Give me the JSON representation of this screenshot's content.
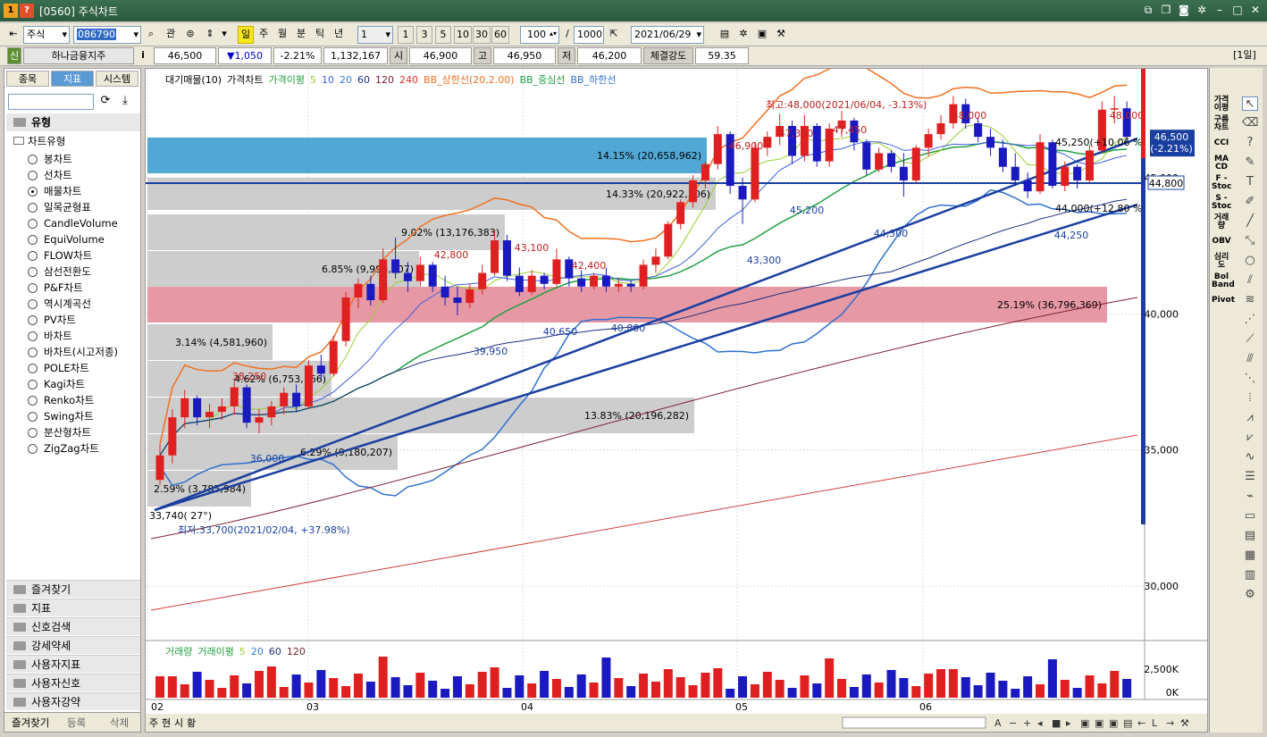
{
  "window": {
    "title": "[0560] 주식차트",
    "num_badge": "1",
    "help_badge": "?"
  },
  "toolbar": {
    "market": "주식",
    "code": "086790",
    "gwan": "관",
    "periods": [
      "일",
      "주",
      "월",
      "분",
      "틱",
      "년"
    ],
    "interval": "1",
    "quick_intervals": [
      "1",
      "3",
      "5",
      "10",
      "30",
      "60"
    ],
    "count_value": "100",
    "count_max": "1000",
    "date": "2021/06/29"
  },
  "info": {
    "badge": "신",
    "name": "하나금융지주",
    "i_label": "i",
    "price": "46,500",
    "change": "▼1,050",
    "change_pct": "-2.21%",
    "volume": "1,132,167",
    "open_label": "시",
    "open": "46,900",
    "high_label": "고",
    "high": "46,950",
    "low_label": "저",
    "low": "46,200",
    "strength_label": "체결강도",
    "strength": "59.35",
    "period_label": "[1일]"
  },
  "left_panel": {
    "tabs": [
      "종목",
      "지표",
      "시스템"
    ],
    "section_title": "유형",
    "group": "차트유형",
    "items": [
      "봉차트",
      "선차트",
      "매물차트",
      "일목균형표",
      "CandleVolume",
      "EquiVolume",
      "FLOW차트",
      "삼선전환도",
      "P&F차트",
      "역시계곡선",
      "PV차트",
      "바차트",
      "바차트(시고저종)",
      "POLE차트",
      "Kagi차트",
      "Renko차트",
      "Swing차트",
      "분산형차트",
      "ZigZag차트"
    ],
    "selected_index": 2,
    "folders": [
      "즐겨찾기",
      "지표",
      "신호검색",
      "강세약세",
      "사용자지표",
      "사용자신호",
      "사용자강약"
    ],
    "bottom_tabs": [
      "즐겨찾기",
      "등록",
      "삭제"
    ]
  },
  "chart": {
    "legend": [
      "대기매물(10)",
      "가격차트",
      "가격이평",
      "5",
      "10",
      "20",
      "60",
      "120",
      "240",
      "BB_상한선(20,2.00)",
      "BB_중심선",
      "BB_하한선"
    ],
    "volume_legend": [
      "거래량",
      "거래이평",
      "5",
      "20",
      "60",
      "120"
    ],
    "y_ticks": [
      "40,000",
      "35,000",
      "30,000"
    ],
    "y_tick_45": "45,000",
    "volume_ticks": [
      "2,500K",
      "0K"
    ],
    "x_ticks": [
      "02",
      "03",
      "04",
      "05",
      "06"
    ],
    "price_tag": "46,500",
    "price_tag_pct": "(-2.21%)",
    "line_tag": "44,800",
    "max_note": "최고:48,000(2021/06/04, -3.13%)",
    "min_note": "최저:33,700(2021/02/04, +37.98%)",
    "angle_note": "33,740( 27°)",
    "trend_note": "44,000(+12.80 %)",
    "trend_note2": "45,250(+10.06 %)",
    "price_labels": [
      "48,000",
      "48,000",
      "47,350",
      "47,450",
      "46,900",
      "45,200",
      "44,300",
      "44,250",
      "43,300",
      "43,100",
      "42,800",
      "42,400",
      "40,650",
      "40,800",
      "39,950",
      "38,250",
      "36,000"
    ],
    "volume_profile": [
      {
        "label": "14.15% (20,658,962)"
      },
      {
        "label": "14.33% (20,922,506)"
      },
      {
        "label": "9.02% (13,176,383)"
      },
      {
        "label": "6.85% (9,998,207)"
      },
      {
        "label": "25.19% (36,796,369)"
      },
      {
        "label": "3.14% (4,581,960)"
      },
      {
        "label": "4.62% (6,753,166)"
      },
      {
        "label": "13.83% (20,196,282)"
      },
      {
        "label": "6.29% (9,180,207)"
      },
      {
        "label": "2.59% (3,785,984)"
      }
    ]
  },
  "chart_data": {
    "type": "candlestick",
    "ylim": [
      28000,
      49000
    ],
    "candles": [
      [
        33900,
        35200,
        33700,
        34800
      ],
      [
        34800,
        36500,
        34500,
        36200
      ],
      [
        36200,
        37200,
        35800,
        36900
      ],
      [
        36900,
        37000,
        35900,
        36200
      ],
      [
        36200,
        36700,
        35800,
        36400
      ],
      [
        36400,
        36900,
        36100,
        36600
      ],
      [
        36600,
        37600,
        36300,
        37300
      ],
      [
        37300,
        37400,
        35800,
        36000
      ],
      [
        36000,
        36500,
        35600,
        36200
      ],
      [
        36200,
        36800,
        35900,
        36600
      ],
      [
        36600,
        37300,
        36300,
        37100
      ],
      [
        37100,
        37400,
        36400,
        36600
      ],
      [
        36600,
        38300,
        36500,
        38100
      ],
      [
        38100,
        38500,
        37600,
        37800
      ],
      [
        37800,
        39200,
        37700,
        39000
      ],
      [
        39000,
        40800,
        38800,
        40600
      ],
      [
        40600,
        41300,
        40200,
        41100
      ],
      [
        41100,
        41400,
        40300,
        40500
      ],
      [
        40500,
        42400,
        40400,
        42000
      ],
      [
        42000,
        42800,
        41300,
        41500
      ],
      [
        41500,
        41900,
        40800,
        41200
      ],
      [
        41200,
        42100,
        41000,
        41800
      ],
      [
        41800,
        41900,
        40800,
        41000
      ],
      [
        41000,
        41400,
        40300,
        40600
      ],
      [
        40600,
        41000,
        39950,
        40400
      ],
      [
        40400,
        41100,
        40200,
        40900
      ],
      [
        40900,
        41800,
        40700,
        41500
      ],
      [
        41500,
        43100,
        41400,
        42700
      ],
      [
        42700,
        42900,
        41200,
        41400
      ],
      [
        41400,
        41700,
        40650,
        40800
      ],
      [
        40800,
        41600,
        40700,
        41400
      ],
      [
        41400,
        41500,
        40900,
        41100
      ],
      [
        41100,
        42400,
        41000,
        42000
      ],
      [
        42000,
        42100,
        41000,
        41300
      ],
      [
        41300,
        41600,
        40800,
        41000
      ],
      [
        41000,
        41500,
        40900,
        41400
      ],
      [
        41400,
        41700,
        40800,
        41000
      ],
      [
        41000,
        41300,
        40800,
        41100
      ],
      [
        41100,
        41200,
        40800,
        41000
      ],
      [
        41000,
        42000,
        40900,
        41800
      ],
      [
        41800,
        42400,
        41500,
        42100
      ],
      [
        42100,
        43400,
        42000,
        43300
      ],
      [
        43300,
        44200,
        43100,
        44100
      ],
      [
        44100,
        45100,
        43900,
        44900
      ],
      [
        44900,
        45600,
        44600,
        45500
      ],
      [
        45500,
        46900,
        45300,
        46600
      ],
      [
        46600,
        46700,
        44400,
        44700
      ],
      [
        44700,
        45000,
        43300,
        44200
      ],
      [
        44200,
        46300,
        44100,
        46100
      ],
      [
        46100,
        46700,
        45800,
        46500
      ],
      [
        46500,
        47350,
        46200,
        46900
      ],
      [
        46900,
        47100,
        45500,
        45800
      ],
      [
        45800,
        47300,
        45600,
        46900
      ],
      [
        46900,
        47000,
        45400,
        45600
      ],
      [
        45600,
        47000,
        45400,
        46800
      ],
      [
        46800,
        47450,
        46500,
        47100
      ],
      [
        47100,
        47200,
        46000,
        46300
      ],
      [
        46300,
        46400,
        45100,
        45300
      ],
      [
        45300,
        46100,
        45200,
        45900
      ],
      [
        45900,
        46000,
        45200,
        45400
      ],
      [
        45400,
        45900,
        44300,
        44900
      ],
      [
        44900,
        46200,
        44800,
        46100
      ],
      [
        46100,
        46800,
        45800,
        46600
      ],
      [
        46600,
        47300,
        46400,
        47000
      ],
      [
        47000,
        48000,
        46800,
        47700
      ],
      [
        47700,
        47900,
        46800,
        47000
      ],
      [
        47000,
        47200,
        46300,
        46500
      ],
      [
        46500,
        46800,
        45800,
        46100
      ],
      [
        46100,
        46400,
        45200,
        45400
      ],
      [
        45400,
        45900,
        44700,
        44900
      ],
      [
        44900,
        45200,
        44250,
        44500
      ],
      [
        44500,
        46600,
        44400,
        46300
      ],
      [
        46300,
        46400,
        44600,
        44700
      ],
      [
        44700,
        45600,
        44500,
        45400
      ],
      [
        45400,
        45500,
        44600,
        44900
      ],
      [
        44900,
        46200,
        44800,
        46000
      ],
      [
        46000,
        47800,
        45900,
        47500
      ],
      [
        47500,
        48000,
        47000,
        47550
      ],
      [
        47550,
        47800,
        46300,
        46500
      ]
    ]
  }
}
